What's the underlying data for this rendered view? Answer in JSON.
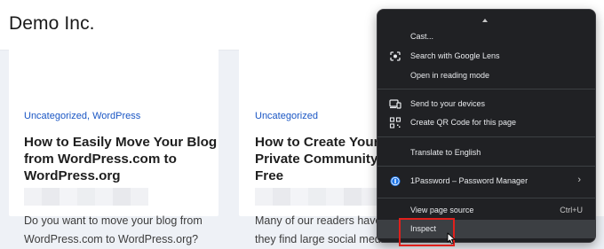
{
  "site": {
    "title": "Demo Inc."
  },
  "posts": [
    {
      "categories": [
        "Uncategorized",
        "WordPress"
      ],
      "category_separator": ", ",
      "title_lines": [
        "How to Easily Move Your Blog",
        "from WordPress.com to",
        "WordPress.org"
      ],
      "excerpt_lines": [
        "Do you want to move your blog from",
        "WordPress.com to WordPress.org?"
      ]
    },
    {
      "categories": [
        "Uncategorized"
      ],
      "title_lines": [
        "How to Create Your O",
        "Private Community w",
        "Free"
      ],
      "excerpt_lines": [
        "Many of our readers have t",
        "they find large social media"
      ]
    }
  ],
  "context_menu": {
    "items": [
      {
        "label": "Cast...",
        "icon": null,
        "shortcut": ""
      },
      {
        "label": "Search with Google Lens",
        "icon": "google-lens-icon",
        "shortcut": ""
      },
      {
        "label": "Open in reading mode",
        "icon": null,
        "shortcut": ""
      },
      {
        "label": "Send to your devices",
        "icon": "devices-icon",
        "shortcut": ""
      },
      {
        "label": "Create QR Code for this page",
        "icon": "qr-code-icon",
        "shortcut": ""
      },
      {
        "label": "Translate to English",
        "icon": null,
        "shortcut": ""
      },
      {
        "label": "1Password – Password Manager",
        "icon": "1password-icon",
        "shortcut": "",
        "submenu": true
      },
      {
        "label": "View page source",
        "icon": null,
        "shortcut": "Ctrl+U"
      },
      {
        "label": "Inspect",
        "icon": null,
        "shortcut": "",
        "hovered": true
      }
    ]
  },
  "colors": {
    "menu_bg": "#202124",
    "menu_text": "#e8eaed",
    "category_link": "#1a56c4",
    "highlight": "#e0201c",
    "page_bg": "#eef1f6"
  }
}
